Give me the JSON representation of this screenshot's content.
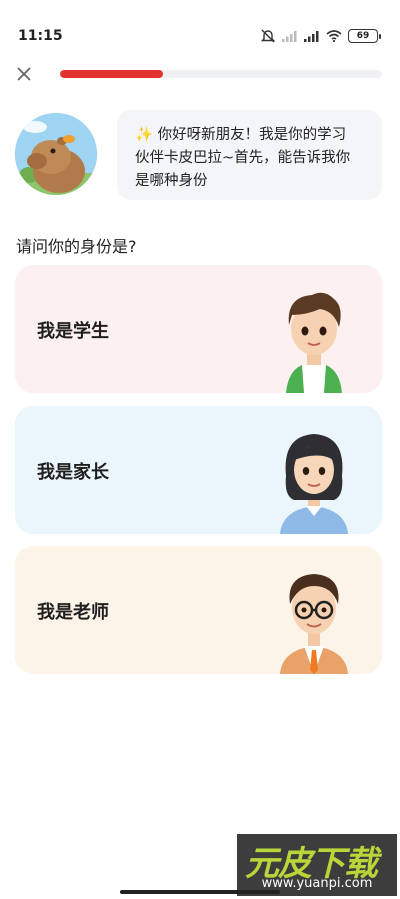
{
  "status_bar": {
    "time": "11:15",
    "battery": "69",
    "icons": [
      "mute-icon",
      "signal-1-icon",
      "signal-2-icon",
      "wifi-icon",
      "battery-icon"
    ]
  },
  "progress": {
    "value": 0.32,
    "color": "#e2332f"
  },
  "greeting": {
    "mascot": "capybara",
    "line1": "✨ 你好呀新朋友！我是你的学习",
    "line2": "伙伴卡皮巴拉~首先，能告诉我你",
    "line3": "是哪种身份"
  },
  "question": "请问你的身份是?",
  "roles": [
    {
      "label": "我是学生",
      "figure": "student-boy",
      "color": "#fdf0f0"
    },
    {
      "label": "我是家长",
      "figure": "parent-woman",
      "color": "#eaf5fc"
    },
    {
      "label": "我是老师",
      "figure": "teacher-man",
      "color": "#fdf4e9"
    }
  ],
  "watermark": {
    "logo": "元皮下载",
    "url": "www.yuanpi.com"
  }
}
